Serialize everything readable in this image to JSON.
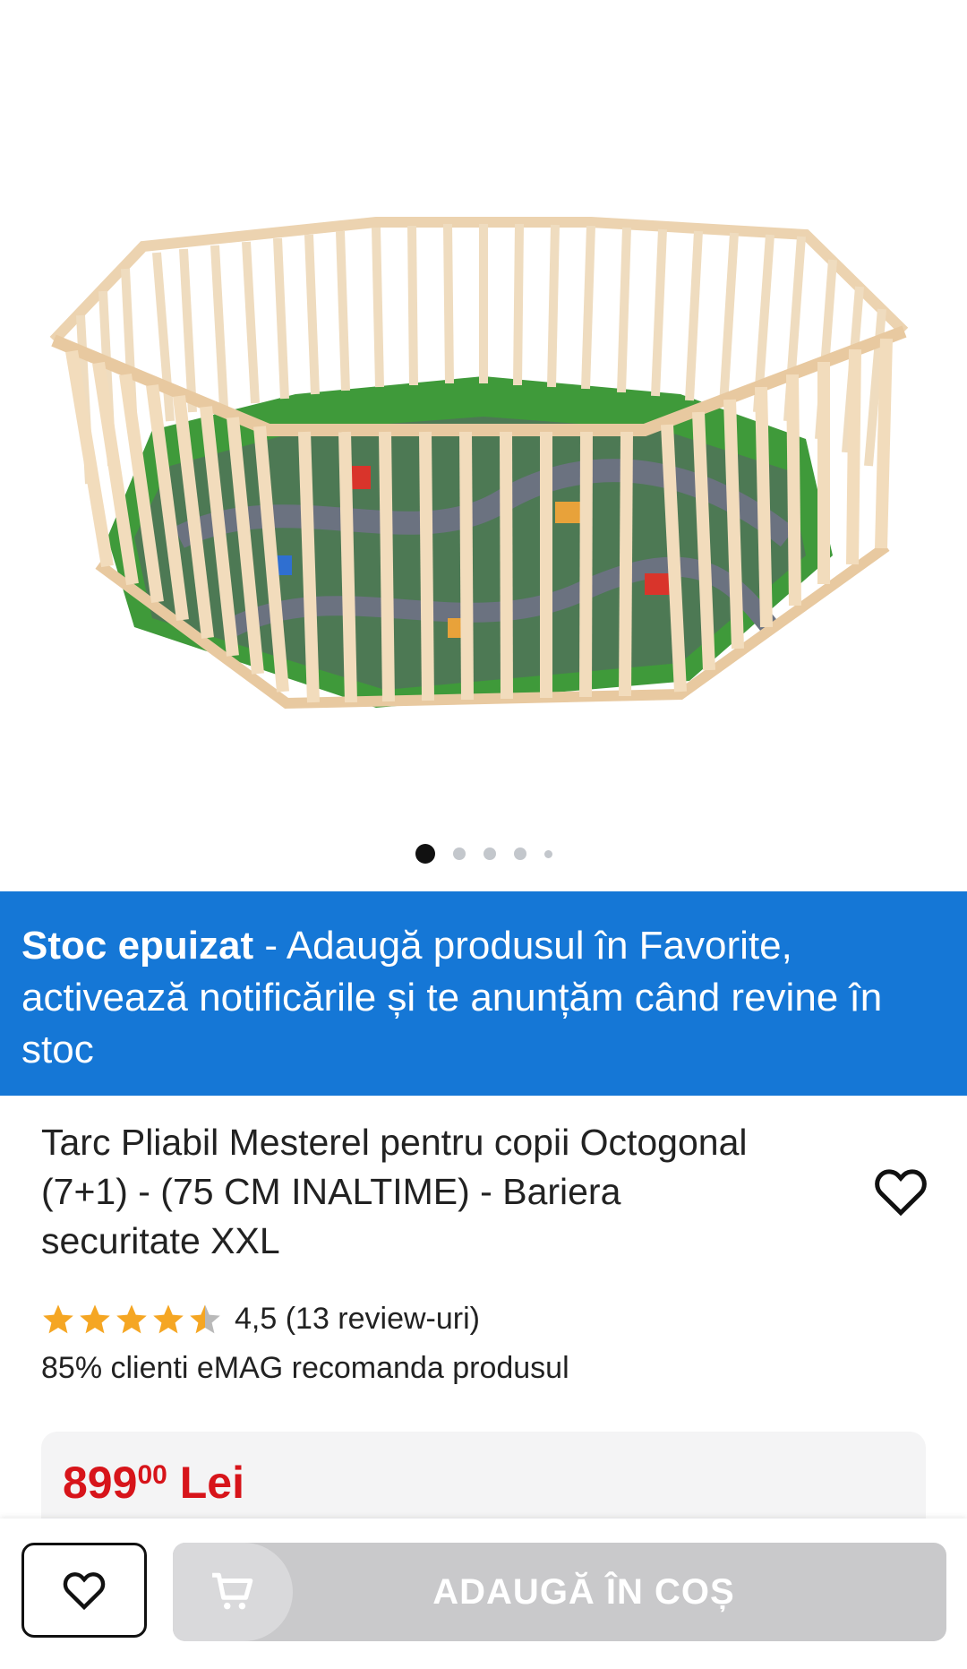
{
  "gallery": {
    "image_alt": "Tarc Pliabil Mesterel octogonal",
    "dots_total": 5,
    "active_dot": 1
  },
  "banner": {
    "bold": "Stoc epuizat",
    "text": " - Adaugă produsul în Favorite, activează notificările și te anunțăm când revine în stoc"
  },
  "product": {
    "title": "Tarc Pliabil Mesterel pentru copii Octogonal (7+1) - (75 CM INALTIME) - Bariera securitate XXL",
    "rating_value": 4.5,
    "rating_text": "4,5 (13 review-uri)",
    "recommend": "85% clienti eMAG recomanda produsul"
  },
  "price": {
    "integer": "899",
    "decimals": "00",
    "currency": "Lei"
  },
  "actions": {
    "add_to_cart": "ADAUGĂ ÎN COȘ",
    "favorite_icon": "heart-icon",
    "cart_icon": "cart-icon"
  },
  "colors": {
    "banner_bg": "#1577d6",
    "price": "#d7141a",
    "star": "#f5a623",
    "cart_disabled": "#c9c9cb"
  }
}
